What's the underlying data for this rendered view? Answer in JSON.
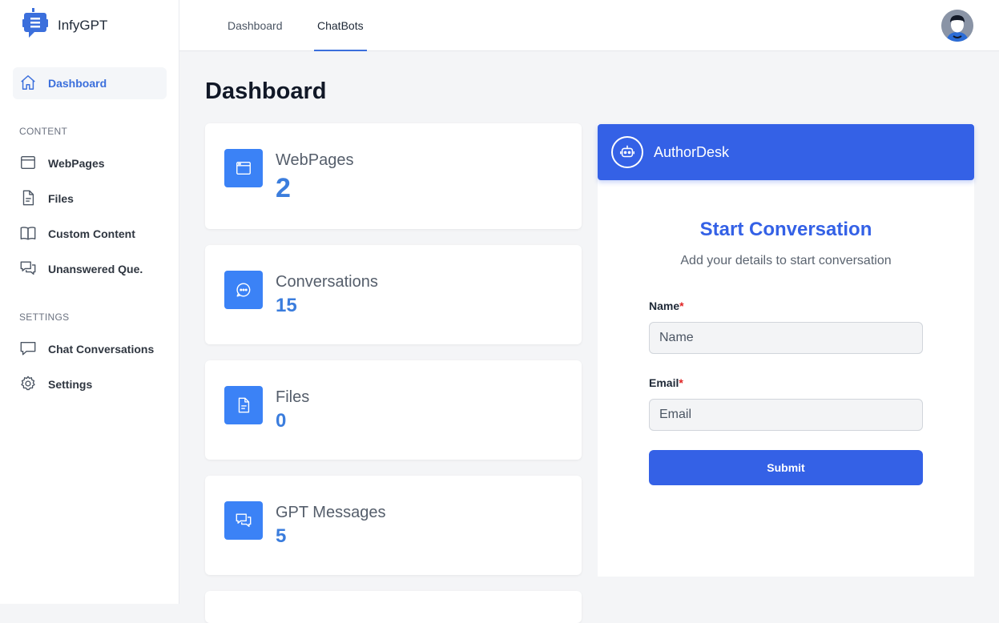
{
  "brand": {
    "name": "InfyGPT"
  },
  "sidebar": {
    "active": {
      "label": "Dashboard",
      "icon": "home-icon"
    },
    "sections": [
      {
        "title": "CONTENT",
        "items": [
          {
            "label": "WebPages",
            "icon": "browser-window-icon"
          },
          {
            "label": "Files",
            "icon": "file-icon"
          },
          {
            "label": "Custom Content",
            "icon": "book-icon"
          },
          {
            "label": "Unanswered Que.",
            "icon": "chat-bubbles-icon"
          }
        ]
      },
      {
        "title": "SETTINGS",
        "items": [
          {
            "label": "Chat Conversations",
            "icon": "chat-bubble-icon"
          },
          {
            "label": "Settings",
            "icon": "gear-icon"
          }
        ]
      }
    ]
  },
  "topbar": {
    "tabs": [
      {
        "label": "Dashboard",
        "active": false
      },
      {
        "label": "ChatBots",
        "active": true
      }
    ]
  },
  "page": {
    "title": "Dashboard"
  },
  "stats": [
    {
      "label": "WebPages",
      "value": "2",
      "icon": "browser-window-icon"
    },
    {
      "label": "Conversations",
      "value": "15",
      "icon": "chat-dots-icon"
    },
    {
      "label": "Files",
      "value": "0",
      "icon": "file-icon"
    },
    {
      "label": "GPT Messages",
      "value": "5",
      "icon": "chat-bubbles-icon"
    }
  ],
  "chat": {
    "bot_name": "AuthorDesk",
    "title": "Start Conversation",
    "subtitle": "Add your details to start conversation",
    "name_label": "Name",
    "name_placeholder": "Name",
    "email_label": "Email",
    "email_placeholder": "Email",
    "required_mark": "*",
    "submit_label": "Submit"
  },
  "colors": {
    "accent": "#3461e6",
    "stat_icon_bg": "#3b82f6",
    "stat_value": "#3b7ddd",
    "required": "#e02424"
  }
}
